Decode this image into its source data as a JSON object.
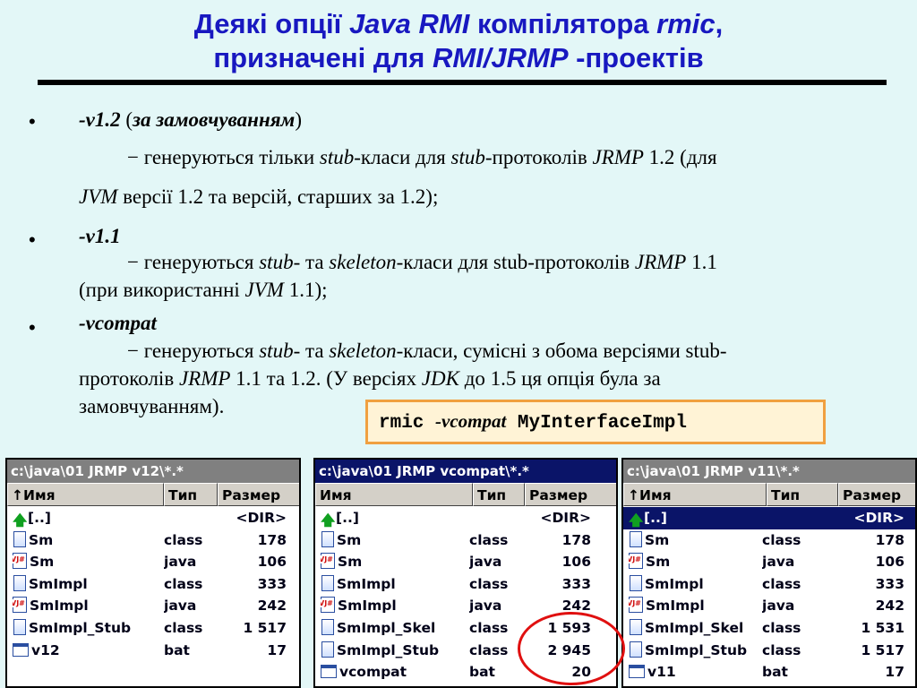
{
  "title": {
    "l1_a": "Деякі опції ",
    "l1_b": "Java RMI",
    "l1_c": " компілятора ",
    "l1_d": "rmic",
    "l1_e": ",",
    "l2_a": "призначені для ",
    "l2_b": "RMI/JRMP",
    "l2_c": " -проектів"
  },
  "bullets": {
    "mark": "•",
    "b1": {
      "opt": "-v1.2",
      "p_open": " (",
      "default": "за замовчуванням",
      "p_close": ")",
      "l2_a": "− генеруються тільки ",
      "l2_b": "stub",
      "l2_c": "-класи для ",
      "l2_d": "stub",
      "l2_e": "-протоколів ",
      "l2_f": "JRMP",
      "l2_g": " 1.2 (для",
      "l3_a": "JVM",
      "l3_b": " версії 1.2 та версій, старших за 1.2);"
    },
    "b2": {
      "opt": "-v1.1",
      "l2_a": "− генеруються ",
      "l2_b": "stub",
      "l2_c": "- та ",
      "l2_d": "skeleton",
      "l2_e": "-класи для stub-протоколів ",
      "l2_f": "JRMP",
      "l2_g": " 1.1",
      "l3_a": "(при використанні ",
      "l3_b": "JVM",
      "l3_c": " 1.1);"
    },
    "b3": {
      "opt": "-vcompat",
      "l2_a": "− генеруються ",
      "l2_b": "stub",
      "l2_c": "- та ",
      "l2_d": "skeleton",
      "l2_e": "-класи, сумісні з обома версіями stub-",
      "l3_a": "протоколів ",
      "l3_b": "JRMP",
      "l3_c": " 1.1 та 1.2. (У версіях ",
      "l3_d": "JDK",
      "l3_e": " до 1.5 ця опція була за",
      "l4_a": "замовчуванням)."
    }
  },
  "command": {
    "cmd": "rmic ",
    "opt": "-vcompat",
    "cls": " MyInterfaceImpl"
  },
  "colors": {
    "title": "#1818c0",
    "background": "#e3f7f7",
    "panel_header_active": "#0a1468",
    "highlight_circle": "#e01010",
    "command_border": "#f0a040"
  },
  "panels": {
    "p1": {
      "path": "c:\\java\\01 JRMP v12\\*.*",
      "col_name": "↑Имя",
      "col_type": "Тип",
      "col_size": "Размер",
      "rows": [
        {
          "name": "[..]",
          "type": "",
          "size": "<DIR>",
          "icon": "up-arrow-icon"
        },
        {
          "name": "Sm",
          "type": "class",
          "size": "178",
          "icon": "class-file-icon"
        },
        {
          "name": "Sm",
          "type": "java",
          "size": "106",
          "icon": "java-file-icon"
        },
        {
          "name": "SmImpl",
          "type": "class",
          "size": "333",
          "icon": "class-file-icon"
        },
        {
          "name": "SmImpl",
          "type": "java",
          "size": "242",
          "icon": "java-file-icon"
        },
        {
          "name": "SmImpl_Stub",
          "type": "class",
          "size": "1 517",
          "icon": "class-file-icon"
        },
        {
          "name": "v12",
          "type": "bat",
          "size": "17",
          "icon": "bat-file-icon"
        }
      ]
    },
    "p2": {
      "path": "c:\\java\\01 JRMP vcompat\\*.*",
      "col_name": "Имя",
      "col_type": "Тип",
      "col_size": "Размер",
      "rows": [
        {
          "name": "[..]",
          "type": "",
          "size": "<DIR>",
          "icon": "up-arrow-icon"
        },
        {
          "name": "Sm",
          "type": "class",
          "size": "178",
          "icon": "class-file-icon"
        },
        {
          "name": "Sm",
          "type": "java",
          "size": "106",
          "icon": "java-file-icon"
        },
        {
          "name": "SmImpl",
          "type": "class",
          "size": "333",
          "icon": "class-file-icon"
        },
        {
          "name": "SmImpl",
          "type": "java",
          "size": "242",
          "icon": "java-file-icon"
        },
        {
          "name": "SmImpl_Skel",
          "type": "class",
          "size": "1 593",
          "icon": "class-file-icon"
        },
        {
          "name": "SmImpl_Stub",
          "type": "class",
          "size": "2 945",
          "icon": "class-file-icon"
        },
        {
          "name": "vcompat",
          "type": "bat",
          "size": "20",
          "icon": "bat-file-icon"
        }
      ]
    },
    "p3": {
      "path": "c:\\java\\01 JRMP v11\\*.*",
      "col_name": "↑Имя",
      "col_type": "Тип",
      "col_size": "Размер",
      "rows": [
        {
          "name": "[..]",
          "type": "",
          "size": "<DIR>",
          "icon": "up-arrow-icon"
        },
        {
          "name": "Sm",
          "type": "class",
          "size": "178",
          "icon": "class-file-icon"
        },
        {
          "name": "Sm",
          "type": "java",
          "size": "106",
          "icon": "java-file-icon"
        },
        {
          "name": "SmImpl",
          "type": "class",
          "size": "333",
          "icon": "class-file-icon"
        },
        {
          "name": "SmImpl",
          "type": "java",
          "size": "242",
          "icon": "java-file-icon"
        },
        {
          "name": "SmImpl_Skel",
          "type": "class",
          "size": "1 531",
          "icon": "class-file-icon"
        },
        {
          "name": "SmImpl_Stub",
          "type": "class",
          "size": "1 517",
          "icon": "class-file-icon"
        },
        {
          "name": "v11",
          "type": "bat",
          "size": "17",
          "icon": "bat-file-icon"
        }
      ]
    }
  }
}
